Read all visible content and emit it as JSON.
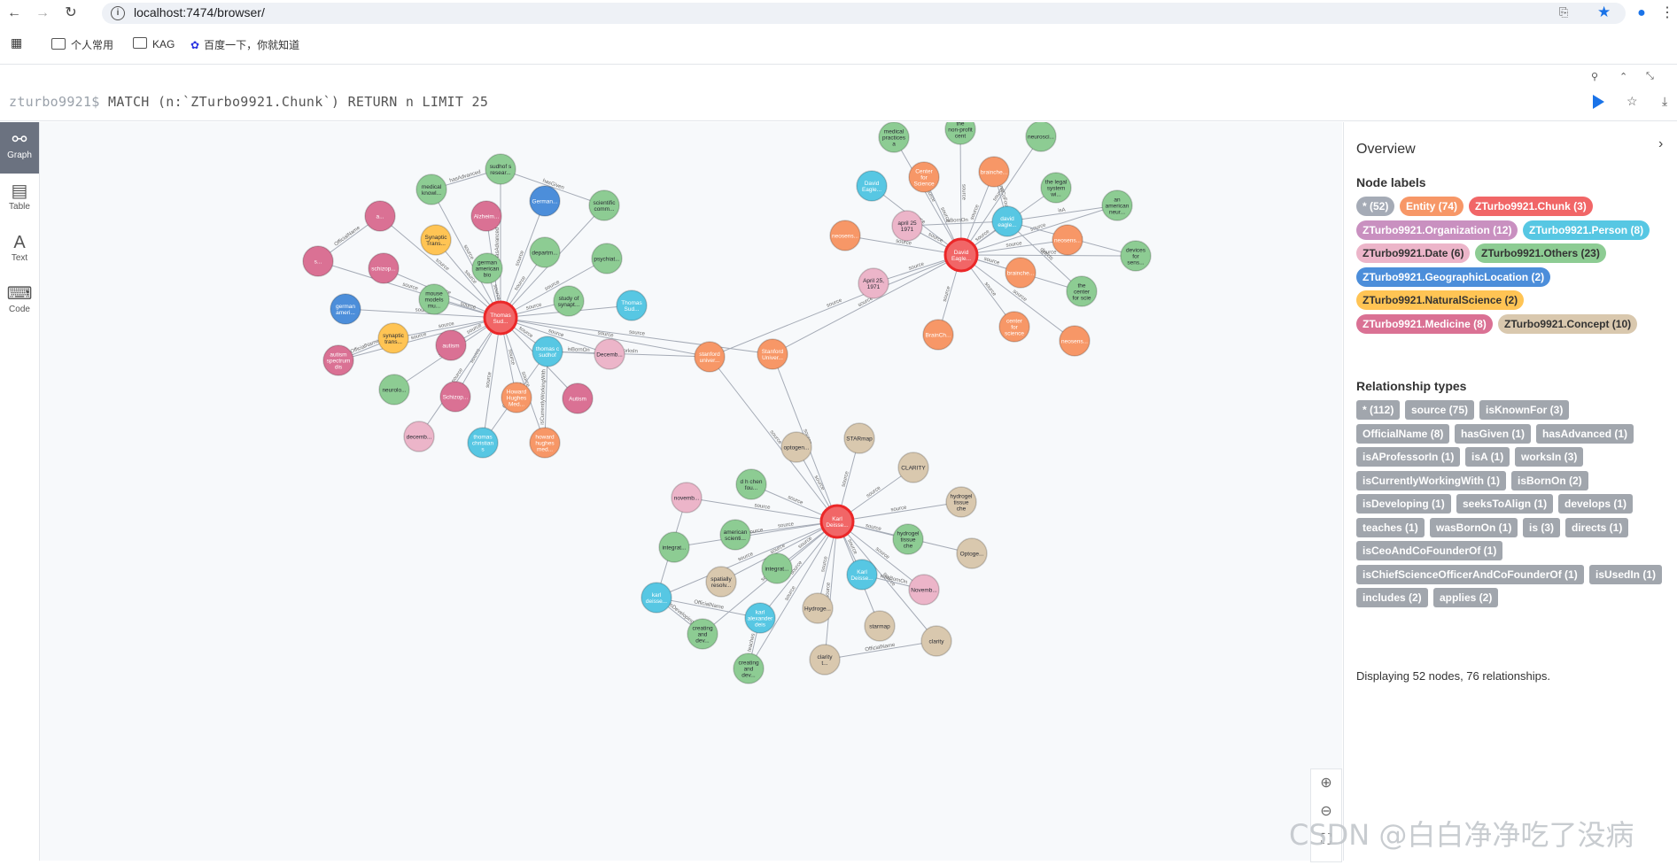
{
  "browser": {
    "url": "localhost:7474/browser/",
    "bookmarks": [
      "个人常用",
      "KAG",
      "百度一下，你就知道"
    ]
  },
  "editor": {
    "prompt": "zturbo9921$",
    "query": "MATCH (n:`ZTurbo9921.Chunk`) RETURN n LIMIT 25"
  },
  "sidebar": [
    {
      "label": "Graph",
      "icon": "graph-icon",
      "active": true
    },
    {
      "label": "Table",
      "icon": "table-icon",
      "active": false
    },
    {
      "label": "Text",
      "icon": "text-icon",
      "active": false
    },
    {
      "label": "Code",
      "icon": "code-icon",
      "active": false
    }
  ],
  "overview": {
    "title": "Overview",
    "node_labels_title": "Node labels",
    "node_labels": [
      {
        "label": "* (52)",
        "color": "#a5abb6"
      },
      {
        "label": "Entity (74)",
        "color": "#f79767"
      },
      {
        "label": "ZTurbo9921.Chunk (3)",
        "color": "#f16667"
      },
      {
        "label": "ZTurbo9921.Organization (12)",
        "color": "#c990c0"
      },
      {
        "label": "ZTurbo9921.Person (8)",
        "color": "#57c7e3"
      },
      {
        "label": "ZTurbo9921.Date (6)",
        "color": "#ecb5c9"
      },
      {
        "label": "ZTurbo9921.Others (23)",
        "color": "#8dcc93"
      },
      {
        "label": "ZTurbo9921.GeographicLocation (2)",
        "color": "#4c8eda"
      },
      {
        "label": "ZTurbo9921.NaturalScience (2)",
        "color": "#ffc454"
      },
      {
        "label": "ZTurbo9921.Medicine (8)",
        "color": "#da7194"
      },
      {
        "label": "ZTurbo9921.Concept (10)",
        "color": "#d9c8ae"
      }
    ],
    "rel_types_title": "Relationship types",
    "rel_types": [
      "* (112)",
      "source (75)",
      "isKnownFor (3)",
      "OfficialName (8)",
      "hasGiven (1)",
      "hasAdvanced (1)",
      "isAProfessorIn (1)",
      "isA (1)",
      "worksIn (3)",
      "isCurrentlyWorkingWith (1)",
      "isBornOn (2)",
      "isDeveloping (1)",
      "seeksToAlign (1)",
      "develops (1)",
      "teaches (1)",
      "wasBornOn (1)",
      "is (3)",
      "directs (1)",
      "isCeoAndCoFounderOf (1)",
      "isChiefScienceOfficerAndCoFounderOf (1)",
      "isUsedIn (1)",
      "includes (2)",
      "applies (2)"
    ],
    "display_text": "Displaying 52 nodes, 76 relationships."
  },
  "graph": {
    "colors": {
      "chunk": "#f16667",
      "entity": "#f79767",
      "org": "#c990c0",
      "person": "#57c7e3",
      "date": "#ecb5c9",
      "others": "#8dcc93",
      "geo": "#4c8eda",
      "ns": "#ffc454",
      "med": "#da7194",
      "concept": "#d9c8ae"
    },
    "nodes": [
      {
        "id": "c1",
        "label": "Thomas Sud...",
        "type": "chunk"
      },
      {
        "id": "c2",
        "label": "David Eagle...",
        "type": "chunk"
      },
      {
        "id": "c3",
        "label": "Karl Deisse...",
        "type": "chunk"
      },
      {
        "id": "n1",
        "label": "sudhof s resear...",
        "type": "others"
      },
      {
        "id": "n2",
        "label": "medical knowl...",
        "type": "others"
      },
      {
        "id": "n3",
        "label": "German...",
        "type": "geo"
      },
      {
        "id": "n4",
        "label": "scientific comm...",
        "type": "others"
      },
      {
        "id": "n5",
        "label": "Alzheim...",
        "type": "med"
      },
      {
        "id": "n6",
        "label": "a...",
        "type": "med"
      },
      {
        "id": "n7",
        "label": "Synaptic Trans...",
        "type": "ns"
      },
      {
        "id": "n8",
        "label": "s...",
        "type": "med"
      },
      {
        "id": "n9",
        "label": "schizop...",
        "type": "med"
      },
      {
        "id": "n10",
        "label": "german american bio",
        "type": "others"
      },
      {
        "id": "n11",
        "label": "departm...",
        "type": "others"
      },
      {
        "id": "n12",
        "label": "psychiat...",
        "type": "others"
      },
      {
        "id": "n13",
        "label": "mouse models mu...",
        "type": "others"
      },
      {
        "id": "n14",
        "label": "german ameri...",
        "type": "geo"
      },
      {
        "id": "n15",
        "label": "study of synapt...",
        "type": "others"
      },
      {
        "id": "n16",
        "label": "Thomas Sud...",
        "type": "person"
      },
      {
        "id": "n17",
        "label": "synaptic trans...",
        "type": "ns"
      },
      {
        "id": "n18",
        "label": "autism",
        "type": "med"
      },
      {
        "id": "n19",
        "label": "thomas c sudhof",
        "type": "person"
      },
      {
        "id": "n20",
        "label": "Decemb...",
        "type": "date"
      },
      {
        "id": "n21",
        "label": "autism spectrum dis",
        "type": "med"
      },
      {
        "id": "n22",
        "label": "neurolo...",
        "type": "others"
      },
      {
        "id": "n23",
        "label": "Schizop...",
        "type": "med"
      },
      {
        "id": "n24",
        "label": "Howard Hughes Med...",
        "type": "entity"
      },
      {
        "id": "n25",
        "label": "Autism",
        "type": "med"
      },
      {
        "id": "n26",
        "label": "decemb...",
        "type": "date"
      },
      {
        "id": "n27",
        "label": "thomas christian s",
        "type": "person"
      },
      {
        "id": "n28",
        "label": "howard hughes med...",
        "type": "entity"
      },
      {
        "id": "n29",
        "label": "stanford univer...",
        "type": "entity"
      },
      {
        "id": "n30",
        "label": "Stanford Univer...",
        "type": "entity"
      },
      {
        "id": "m1",
        "label": "medical practices a",
        "type": "others"
      },
      {
        "id": "m2",
        "label": "the non-profit cent",
        "type": "others"
      },
      {
        "id": "m3",
        "label": "neurosci...",
        "type": "others"
      },
      {
        "id": "m4",
        "label": "David Eagle...",
        "type": "person"
      },
      {
        "id": "m5",
        "label": "Center for Science",
        "type": "entity"
      },
      {
        "id": "m6",
        "label": "brainche...",
        "type": "entity"
      },
      {
        "id": "m7",
        "label": "the legal system wi...",
        "type": "others"
      },
      {
        "id": "m8",
        "label": "april 25 1971",
        "type": "date"
      },
      {
        "id": "m9",
        "label": "david eagle...",
        "type": "person"
      },
      {
        "id": "m10",
        "label": "an american neur...",
        "type": "others"
      },
      {
        "id": "m11",
        "label": "neosens...",
        "type": "entity"
      },
      {
        "id": "m12",
        "label": "neosens...",
        "type": "entity"
      },
      {
        "id": "m13",
        "label": "devices for sens...",
        "type": "others"
      },
      {
        "id": "m14",
        "label": "April 25, 1971",
        "type": "date"
      },
      {
        "id": "m15",
        "label": "brainche...",
        "type": "entity"
      },
      {
        "id": "m16",
        "label": "the center for scie",
        "type": "others"
      },
      {
        "id": "m17",
        "label": "BrainCh...",
        "type": "entity"
      },
      {
        "id": "m18",
        "label": "center for science",
        "type": "entity"
      },
      {
        "id": "m19",
        "label": "neosens...",
        "type": "entity"
      },
      {
        "id": "k1",
        "label": "optogen...",
        "type": "concept"
      },
      {
        "id": "k2",
        "label": "STARmap",
        "type": "concept"
      },
      {
        "id": "k3",
        "label": "CLARITY",
        "type": "concept"
      },
      {
        "id": "k4",
        "label": "d h chen fou...",
        "type": "others"
      },
      {
        "id": "k5",
        "label": "novemb...",
        "type": "date"
      },
      {
        "id": "k6",
        "label": "hydrogel tissue che",
        "type": "concept"
      },
      {
        "id": "k7",
        "label": "american scienti...",
        "type": "others"
      },
      {
        "id": "k8",
        "label": "integrat...",
        "type": "others"
      },
      {
        "id": "k9",
        "label": "hydrogel tissue che",
        "type": "others"
      },
      {
        "id": "k10",
        "label": "Optoge...",
        "type": "concept"
      },
      {
        "id": "k11",
        "label": "integrat...",
        "type": "others"
      },
      {
        "id": "k12",
        "label": "spatially resolv...",
        "type": "concept"
      },
      {
        "id": "k13",
        "label": "Karl Deisse...",
        "type": "person"
      },
      {
        "id": "k14",
        "label": "Novemb...",
        "type": "date"
      },
      {
        "id": "k15",
        "label": "karl deisse...",
        "type": "person"
      },
      {
        "id": "k16",
        "label": "Hydroge...",
        "type": "concept"
      },
      {
        "id": "k17",
        "label": "karl alexander deis",
        "type": "person"
      },
      {
        "id": "k18",
        "label": "starmap",
        "type": "concept"
      },
      {
        "id": "k19",
        "label": "creating and dev...",
        "type": "others"
      },
      {
        "id": "k20",
        "label": "clarity",
        "type": "concept"
      },
      {
        "id": "k21",
        "label": "clarity t...",
        "type": "concept"
      },
      {
        "id": "k22",
        "label": "creating and dev...",
        "type": "others"
      }
    ],
    "edges": [
      {
        "from": "c1",
        "to": "n1",
        "label": "hasAdvanced"
      },
      {
        "from": "c1",
        "to": "n2",
        "label": "source"
      },
      {
        "from": "c1",
        "to": "n3",
        "label": "source"
      },
      {
        "from": "c1",
        "to": "n4",
        "label": "source"
      },
      {
        "from": "c1",
        "to": "n5",
        "label": "source"
      },
      {
        "from": "c1",
        "to": "n6",
        "label": "source"
      },
      {
        "from": "c1",
        "to": "n7",
        "label": "source"
      },
      {
        "from": "c1",
        "to": "n8",
        "label": "source"
      },
      {
        "from": "c1",
        "to": "n9",
        "label": "source"
      },
      {
        "from": "c1",
        "to": "n10",
        "label": "source"
      },
      {
        "from": "c1",
        "to": "n11",
        "label": "source"
      },
      {
        "from": "c1",
        "to": "n12",
        "label": "source"
      },
      {
        "from": "c1",
        "to": "n13",
        "label": "source"
      },
      {
        "from": "c1",
        "to": "n14",
        "label": "source"
      },
      {
        "from": "c1",
        "to": "n15",
        "label": "source"
      },
      {
        "from": "c1",
        "to": "n16",
        "label": "source"
      },
      {
        "from": "c1",
        "to": "n17",
        "label": "source"
      },
      {
        "from": "c1",
        "to": "n18",
        "label": "source"
      },
      {
        "from": "c1",
        "to": "n19",
        "label": "source"
      },
      {
        "from": "c1",
        "to": "n20",
        "label": "source"
      },
      {
        "from": "c1",
        "to": "n21",
        "label": "source"
      },
      {
        "from": "c1",
        "to": "n22",
        "label": "source"
      },
      {
        "from": "c1",
        "to": "n23",
        "label": "source"
      },
      {
        "from": "c1",
        "to": "n24",
        "label": "source"
      },
      {
        "from": "c1",
        "to": "n25",
        "label": "source"
      },
      {
        "from": "c1",
        "to": "n26",
        "label": "source"
      },
      {
        "from": "c1",
        "to": "n27",
        "label": "source"
      },
      {
        "from": "c1",
        "to": "n28",
        "label": "source"
      },
      {
        "from": "c1",
        "to": "n29",
        "label": "source"
      },
      {
        "from": "c1",
        "to": "n30",
        "label": "source"
      },
      {
        "from": "n1",
        "to": "n2",
        "label": "hasAdvanced"
      },
      {
        "from": "n1",
        "to": "n4",
        "label": "hasGiven"
      },
      {
        "from": "n6",
        "to": "n8",
        "label": "OfficialName"
      },
      {
        "from": "n17",
        "to": "n21",
        "label": "OfficialName"
      },
      {
        "from": "n19",
        "to": "n20",
        "label": "isBornOn"
      },
      {
        "from": "n19",
        "to": "n29",
        "label": "worksIn"
      },
      {
        "from": "n19",
        "to": "n27",
        "label": "OfficialName"
      },
      {
        "from": "n19",
        "to": "n28",
        "label": "isCurrentlyWorkingWith"
      },
      {
        "from": "c2",
        "to": "m1",
        "label": "source"
      },
      {
        "from": "c2",
        "to": "m2",
        "label": "source"
      },
      {
        "from": "c2",
        "to": "m3",
        "label": "source"
      },
      {
        "from": "c2",
        "to": "m4",
        "label": "source"
      },
      {
        "from": "c2",
        "to": "m5",
        "label": "source"
      },
      {
        "from": "c2",
        "to": "m6",
        "label": "source"
      },
      {
        "from": "c2",
        "to": "m7",
        "label": "source"
      },
      {
        "from": "c2",
        "to": "m8",
        "label": "source"
      },
      {
        "from": "c2",
        "to": "m9",
        "label": "source"
      },
      {
        "from": "c2",
        "to": "m10",
        "label": "source"
      },
      {
        "from": "c2",
        "to": "m11",
        "label": "source"
      },
      {
        "from": "c2",
        "to": "m12",
        "label": "source"
      },
      {
        "from": "c2",
        "to": "m13",
        "label": "source"
      },
      {
        "from": "c2",
        "to": "m14",
        "label": "source"
      },
      {
        "from": "c2",
        "to": "m15",
        "label": "source"
      },
      {
        "from": "c2",
        "to": "m16",
        "label": "source"
      },
      {
        "from": "c2",
        "to": "m17",
        "label": "source"
      },
      {
        "from": "c2",
        "to": "m18",
        "label": "source"
      },
      {
        "from": "c2",
        "to": "m19",
        "label": "source"
      },
      {
        "from": "c2",
        "to": "n29",
        "label": "source"
      },
      {
        "from": "c2",
        "to": "n30",
        "label": "source"
      },
      {
        "from": "m9",
        "to": "m8",
        "label": "isBornOn"
      },
      {
        "from": "m9",
        "to": "m10",
        "label": "isA"
      },
      {
        "from": "m9",
        "to": "m16",
        "label": "directs"
      },
      {
        "from": "m9",
        "to": "m6",
        "label": "isCeoAndCoFounderOf"
      },
      {
        "from": "m9",
        "to": "m13",
        "label": "develops"
      },
      {
        "from": "c3",
        "to": "k1",
        "label": "source"
      },
      {
        "from": "c3",
        "to": "k2",
        "label": "source"
      },
      {
        "from": "c3",
        "to": "k3",
        "label": "source"
      },
      {
        "from": "c3",
        "to": "k4",
        "label": "source"
      },
      {
        "from": "c3",
        "to": "k5",
        "label": "source"
      },
      {
        "from": "c3",
        "to": "k6",
        "label": "source"
      },
      {
        "from": "c3",
        "to": "k7",
        "label": "source"
      },
      {
        "from": "c3",
        "to": "k8",
        "label": "source"
      },
      {
        "from": "c3",
        "to": "k9",
        "label": "source"
      },
      {
        "from": "c3",
        "to": "k10",
        "label": "source"
      },
      {
        "from": "c3",
        "to": "k11",
        "label": "source"
      },
      {
        "from": "c3",
        "to": "k12",
        "label": "source"
      },
      {
        "from": "c3",
        "to": "k13",
        "label": "source"
      },
      {
        "from": "c3",
        "to": "k14",
        "label": "source"
      },
      {
        "from": "c3",
        "to": "k15",
        "label": "source"
      },
      {
        "from": "c3",
        "to": "k16",
        "label": "source"
      },
      {
        "from": "c3",
        "to": "k17",
        "label": "source"
      },
      {
        "from": "c3",
        "to": "k18",
        "label": "source"
      },
      {
        "from": "c3",
        "to": "k19",
        "label": "source"
      },
      {
        "from": "c3",
        "to": "k20",
        "label": "source"
      },
      {
        "from": "c3",
        "to": "k21",
        "label": "source"
      },
      {
        "from": "c3",
        "to": "k22",
        "label": "source"
      },
      {
        "from": "c3",
        "to": "n29",
        "label": "source"
      },
      {
        "from": "c3",
        "to": "n30",
        "label": "source"
      },
      {
        "from": "k15",
        "to": "k17",
        "label": "OfficialName"
      },
      {
        "from": "k15",
        "to": "k19",
        "label": "isDeveloping"
      },
      {
        "from": "k15",
        "to": "k5",
        "label": "isBornOn"
      },
      {
        "from": "k20",
        "to": "k21",
        "label": "OfficialName"
      },
      {
        "from": "k13",
        "to": "k14",
        "label": "wasBornOn"
      },
      {
        "from": "k17",
        "to": "k22",
        "label": "teaches"
      }
    ]
  },
  "watermark": "CSDN @白白净净吃了没病"
}
